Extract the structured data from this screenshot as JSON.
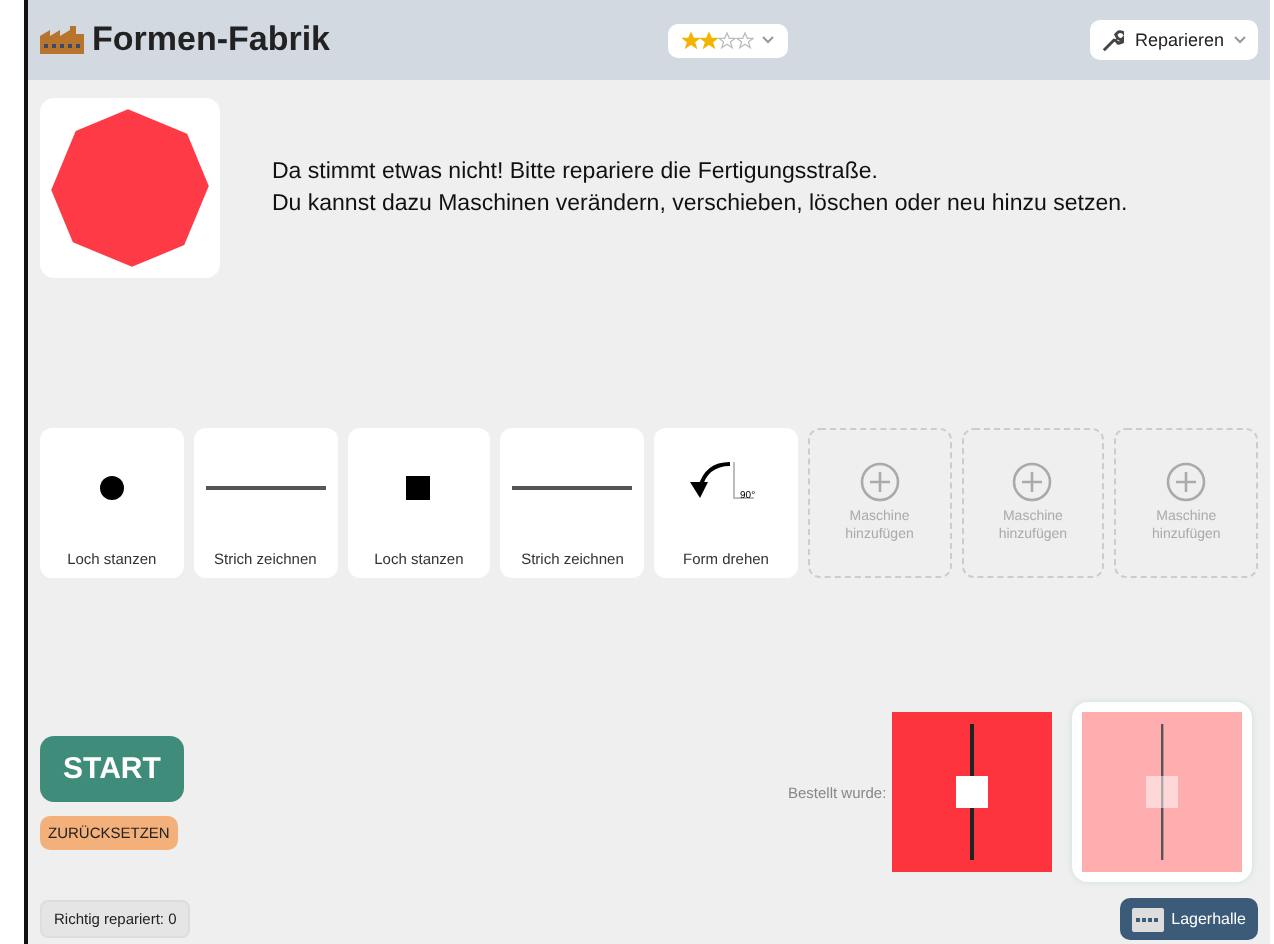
{
  "header": {
    "title": "Formen-Fabrik",
    "stars": 2,
    "repair_label": "Reparieren"
  },
  "target": {
    "kind": "octagon"
  },
  "instructions": [
    "Da stimmt etwas nicht! Bitte repariere die Fertigungsstraße.",
    "Du kannst dazu Maschinen verändern, verschieben, löschen oder neu hinzu setzen."
  ],
  "machines": [
    {
      "kind": "circle_hole",
      "label": "Loch stanzen"
    },
    {
      "kind": "line",
      "label": "Strich zeichnen"
    },
    {
      "kind": "square_hole",
      "label": "Loch stanzen"
    },
    {
      "kind": "line",
      "label": "Strich zeichnen"
    },
    {
      "kind": "rotate",
      "angle": "90°",
      "label": "Form drehen"
    },
    {
      "kind": "empty",
      "label": "Maschine hinzufügen"
    },
    {
      "kind": "empty",
      "label": "Maschine hinzufügen"
    },
    {
      "kind": "empty",
      "label": "Maschine hinzufügen"
    }
  ],
  "start_label": "START",
  "reset_label": "ZURÜCKSETZEN",
  "ordered_label": "Bestellt wurde:",
  "score": "Richtig repariert: 0",
  "warehouse_label": "Lagerhalle"
}
